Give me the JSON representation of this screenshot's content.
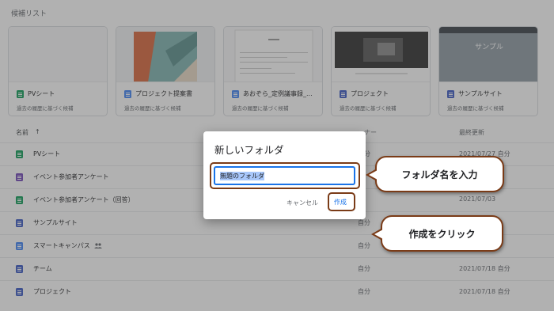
{
  "suggestions_title": "候補リスト",
  "cards": [
    {
      "title": "PVシート",
      "subtitle": "過去の履歴に基づく候補",
      "icon": "sheets-icon"
    },
    {
      "title": "プロジェクト提案書",
      "subtitle": "過去の履歴に基づく候補",
      "icon": "docs-icon"
    },
    {
      "title": "あおぞら_定例議事録_...",
      "subtitle": "過去の履歴に基づく候補",
      "icon": "docs-icon"
    },
    {
      "title": "プロジェクト",
      "subtitle": "過去の履歴に基づく候補",
      "icon": "sites-icon"
    },
    {
      "title": "サンプルサイト",
      "subtitle": "過去の履歴に基づく候補",
      "icon": "sites-icon",
      "thumb_text": "サンプル"
    }
  ],
  "list": {
    "name_header": "名前",
    "sort_arrow": "↑",
    "owner_header": "ーナー",
    "modified_header": "最終更新",
    "rows": [
      {
        "name": "PVシート",
        "owner": "自分",
        "date": "2021/07/27 自分"
      },
      {
        "name": "イベント参加者アンケート",
        "owner": "",
        "date": ""
      },
      {
        "name": "イベント参加者アンケート（回答）",
        "owner": "",
        "date": "2021/07/03"
      },
      {
        "name": "サンプルサイト",
        "owner": "自分",
        "date": ""
      },
      {
        "name": "スマートキャンパス",
        "owner": "自分",
        "date": ""
      },
      {
        "name": "チーム",
        "owner": "自分",
        "date": "2021/07/18 自分"
      },
      {
        "name": "プロジェクト",
        "owner": "自分",
        "date": "2021/07/18 自分"
      }
    ]
  },
  "dialog": {
    "title": "新しいフォルダ",
    "input_value": "無題のフォルダ",
    "cancel_label": "キャンセル",
    "create_label": "作成"
  },
  "callouts": {
    "input_hint": "フォルダ名を入力",
    "click_hint": "作成をクリック"
  },
  "colors": {
    "callout_border": "#7a3b17",
    "accent": "#1a73e8",
    "overlay": "rgba(70,70,70,0.42)"
  }
}
